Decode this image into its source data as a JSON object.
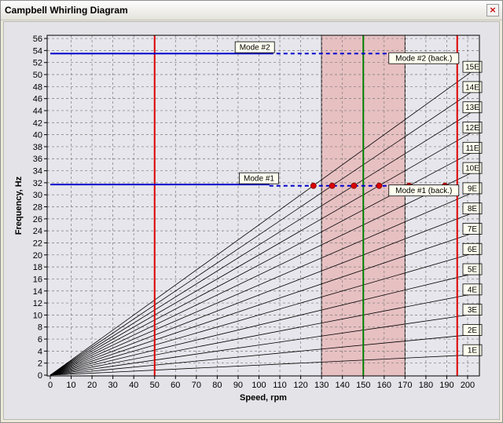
{
  "window": {
    "title": "Campbell Whirling Diagram",
    "close_glyph": "×",
    "close_icon": "close-icon"
  },
  "chart_data": {
    "type": "line",
    "xlabel": "Speed, rpm",
    "ylabel": "Frequency, Hz",
    "xlim": [
      0,
      205
    ],
    "ylim": [
      0,
      57
    ],
    "x_ticks": [
      0,
      10,
      20,
      30,
      40,
      50,
      60,
      70,
      80,
      90,
      100,
      110,
      120,
      130,
      140,
      150,
      160,
      170,
      180,
      190,
      200
    ],
    "y_ticks": [
      0,
      2,
      4,
      6,
      8,
      10,
      12,
      14,
      16,
      18,
      20,
      22,
      24,
      26,
      28,
      30,
      32,
      34,
      36,
      38,
      40,
      42,
      44,
      46,
      48,
      50,
      52,
      54,
      56
    ],
    "grid": true,
    "excitation_lines": {
      "orders": [
        1,
        2,
        3,
        4,
        5,
        6,
        7,
        8,
        9,
        10,
        11,
        12,
        13,
        14,
        15
      ],
      "labels": [
        "1E",
        "2E",
        "3E",
        "4E",
        "5E",
        "6E",
        "7E",
        "8E",
        "9E",
        "10E",
        "11E",
        "12E",
        "13E",
        "14E",
        "15E"
      ],
      "color": "#000000"
    },
    "vertical_lines": [
      {
        "x": 50,
        "color": "#dd0000"
      },
      {
        "x": 195,
        "color": "#dd0000"
      },
      {
        "x": 150,
        "color": "#008000"
      }
    ],
    "band": {
      "x0": 130,
      "x1": 170,
      "color": "#e8a0a0"
    },
    "modes": [
      {
        "name": "Mode #1",
        "freq": 31.7,
        "x_end": 105,
        "color": "#0000cc",
        "label_x": 100
      },
      {
        "name": "Mode #2",
        "freq": 53.5,
        "x_end": 105,
        "color": "#0000cc",
        "label_x": 98
      }
    ],
    "backward_modes": [
      {
        "name": "Mode #1 (back.)",
        "freq": 31.5,
        "x_start": 105,
        "x_end": 195,
        "color": "#0000cc",
        "label_x": 179
      },
      {
        "name": "Mode #2 (back.)",
        "freq": 53.5,
        "x_start": 105,
        "x_end": 195,
        "color": "#0000cc",
        "label_x": 179
      }
    ],
    "intersections": [
      {
        "x": 126.1,
        "y": 31.5,
        "order": 15
      },
      {
        "x": 135.1,
        "y": 31.5,
        "order": 14
      },
      {
        "x": 145.5,
        "y": 31.5,
        "order": 13
      },
      {
        "x": 157.6,
        "y": 31.5,
        "order": 12
      },
      {
        "x": 171.9,
        "y": 31.5,
        "order": 11
      },
      {
        "x": 189.1,
        "y": 31.5,
        "order": 10
      }
    ],
    "intersection_color": "#dd0000"
  }
}
